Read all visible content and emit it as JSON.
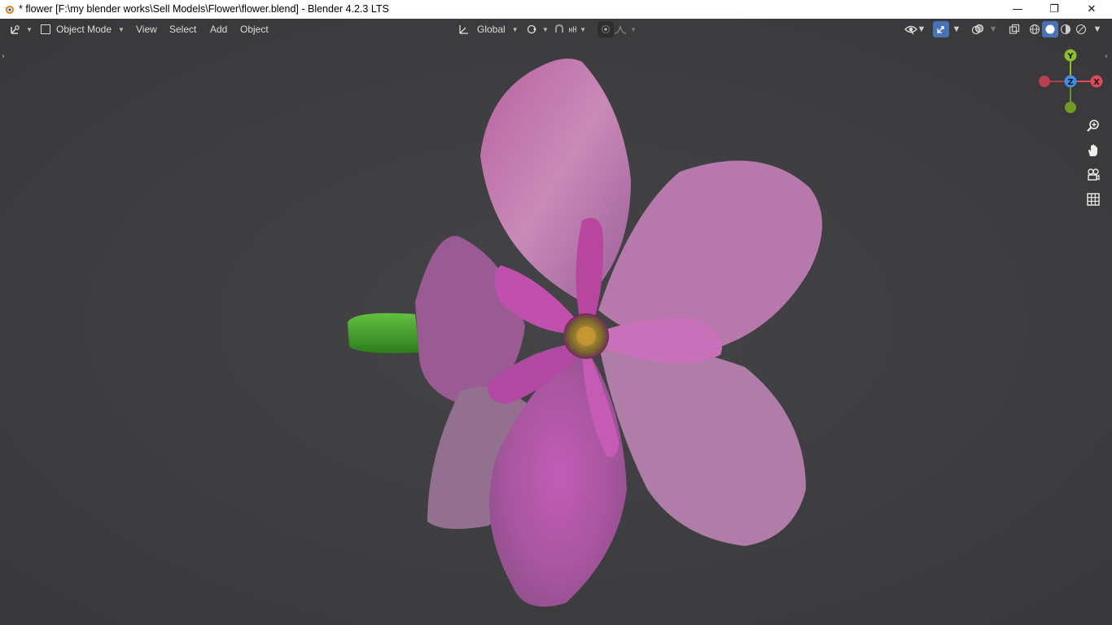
{
  "window": {
    "title": "* flower [F:\\my blender works\\Sell Models\\Flower\\flower.blend] - Blender 4.2.3 LTS",
    "minimize_glyph": "—",
    "maximize_glyph": "❐",
    "close_glyph": "✕"
  },
  "header": {
    "mode_label": "Object Mode",
    "menus": [
      "View",
      "Select",
      "Add",
      "Object"
    ],
    "orientation_label": "Global"
  },
  "gizmo": {
    "y_label": "Y",
    "x_label": "X",
    "z_label": "Z",
    "colors": {
      "x": "#e04a5a",
      "y": "#8bbf2c",
      "z": "#3d8ee8"
    }
  },
  "icons": {
    "editor_type": "3d-view-icon",
    "orientation": "transform-orientation-icon",
    "pivot": "pivot-point-icon",
    "snap": "snap-magnet-icon",
    "snap_target": "snap-increment-icon",
    "proportional": "proportional-edit-icon",
    "falloff": "falloff-curve-icon",
    "visibility": "selectability-visibility-icon",
    "gizmo_toggle": "gizmo-toggle-icon",
    "overlay": "overlay-icon",
    "xray": "xray-icon",
    "shading_wire": "wireframe-shading-icon",
    "shading_solid": "solid-shading-icon",
    "shading_material": "material-preview-icon",
    "shading_rendered": "rendered-shading-icon",
    "zoom": "zoom-icon",
    "pan": "hand-pan-icon",
    "camera": "camera-view-icon",
    "ortho": "ortho-grid-icon"
  },
  "colors": {
    "viewport_bg": "#3d3d3d",
    "accent_blue": "#4772b3",
    "petal": "#b04aa8",
    "stem": "#3da02a",
    "center": "#b8902a"
  }
}
